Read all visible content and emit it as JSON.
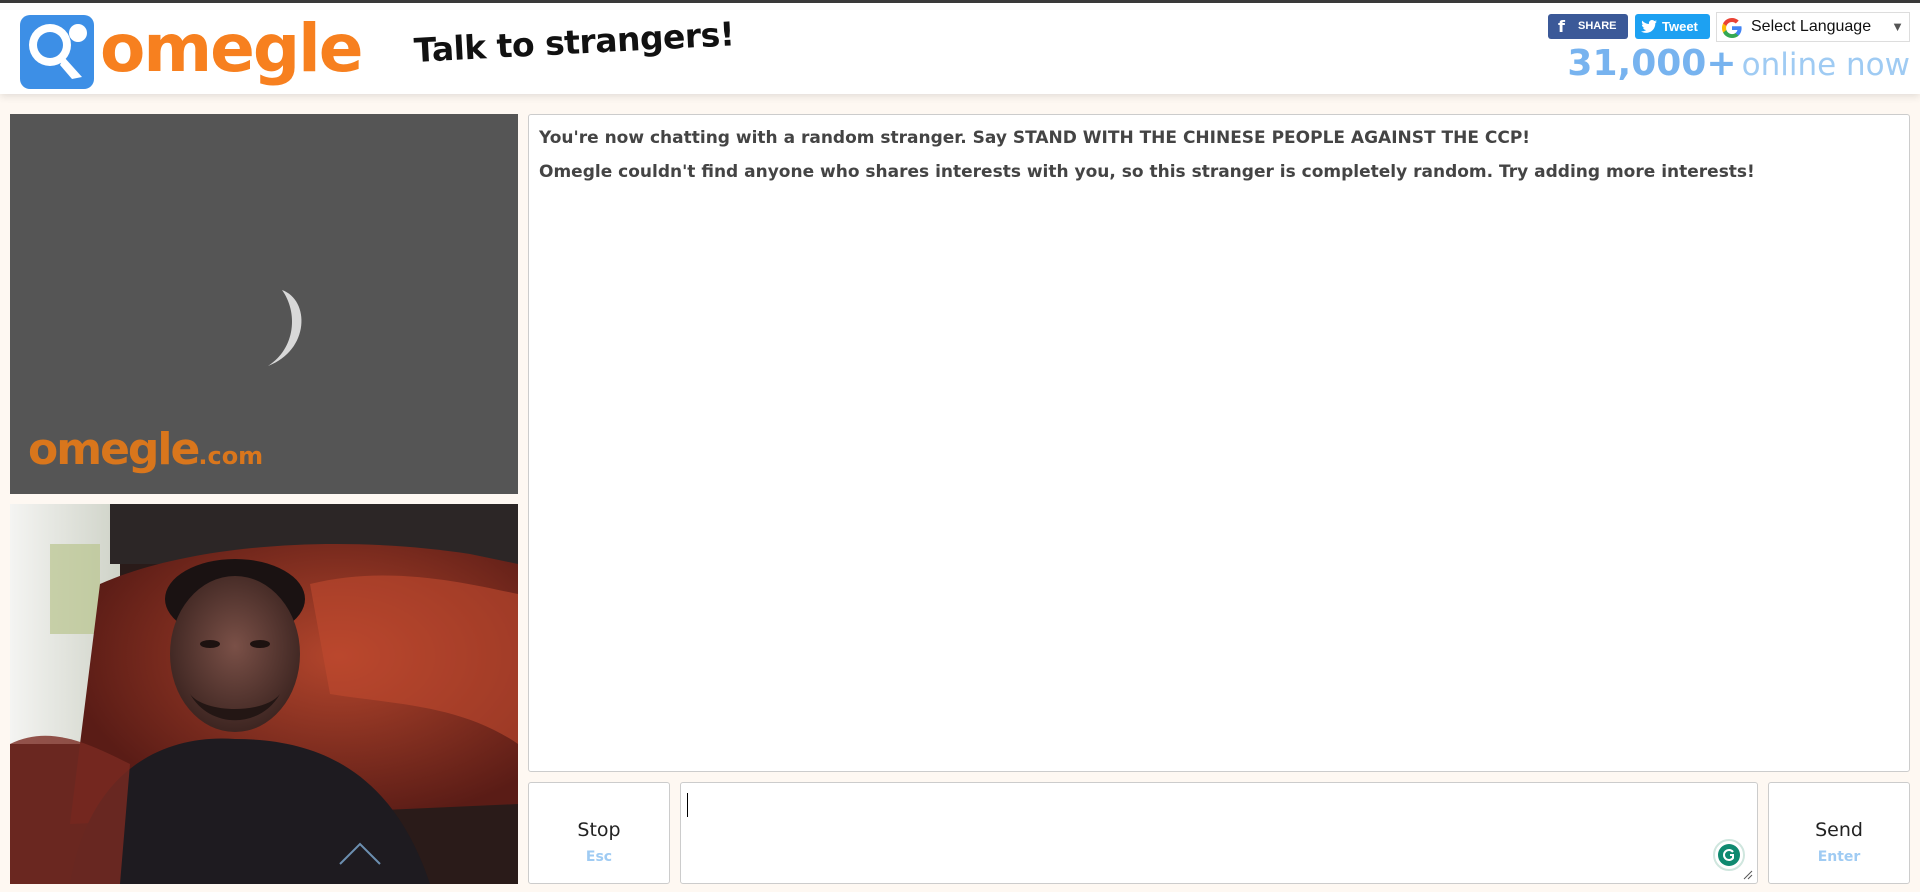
{
  "header": {
    "logo_text": "omegle",
    "tagline": "Talk to strangers!",
    "share_label": "SHARE",
    "tweet_label": "Tweet",
    "language_label": "Select Language",
    "online_count": "31,000+",
    "online_suffix": "online now"
  },
  "stranger_video": {
    "watermark_main": "omegle",
    "watermark_suffix": ".com"
  },
  "chat": {
    "messages": [
      "You're now chatting with a random stranger. Say STAND WITH THE CHINESE PEOPLE AGAINST THE CCP!",
      "Omegle couldn't find anyone who shares interests with you, so this stranger is completely random. Try adding more interests!"
    ]
  },
  "controls": {
    "stop_label": "Stop",
    "stop_shortcut": "Esc",
    "send_label": "Send",
    "send_shortcut": "Enter",
    "message_value": ""
  },
  "icons": {
    "logo": "omegle-chat-bubble-icon",
    "facebook": "facebook-icon",
    "twitter": "twitter-bird-icon",
    "google": "google-g-icon",
    "dropdown": "dropdown-arrow-icon",
    "spinner": "loading-spinner-icon",
    "grammarly": "grammarly-icon",
    "resize": "resize-grip-icon"
  },
  "colors": {
    "brand_orange": "#f7801f",
    "brand_blue": "#3d8fe6",
    "online_blue": "#77b3ef",
    "page_background": "#fef8f2",
    "video_placeholder": "#555555",
    "facebook_blue": "#3b5998",
    "twitter_blue": "#1da1f2"
  }
}
